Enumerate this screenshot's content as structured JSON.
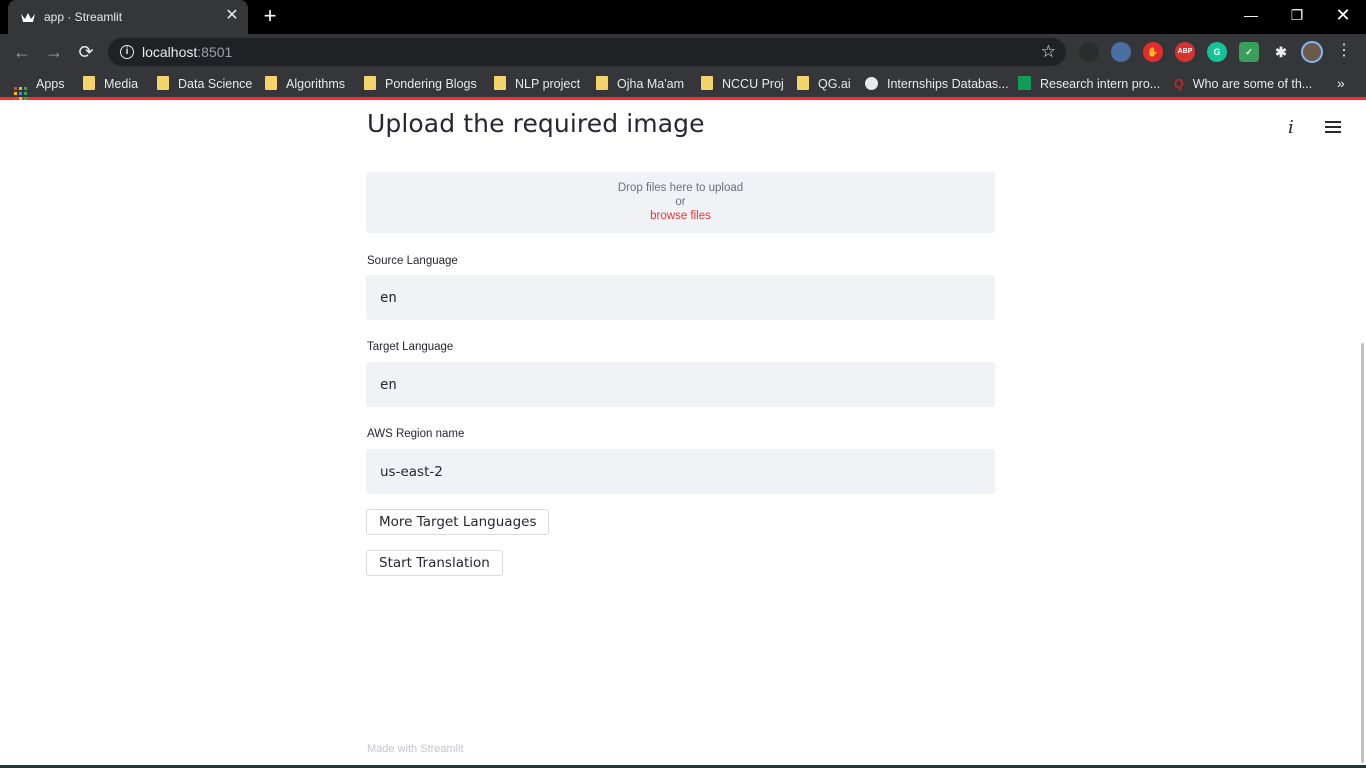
{
  "browser": {
    "tab_title": "app · Streamlit",
    "tab_close": "✕",
    "new_tab": "+",
    "window_controls": {
      "minimize": "—",
      "maximize": "❐",
      "close": "✕"
    },
    "nav": {
      "back": "←",
      "forward": "→",
      "reload": "⟳"
    },
    "url_host": "localhost",
    "url_port": ":8501",
    "bookmarks": [
      {
        "label": "Apps",
        "icon": "apps-grid-icon"
      },
      {
        "label": "Media",
        "icon": "folder-icon"
      },
      {
        "label": "Data Science",
        "icon": "folder-icon"
      },
      {
        "label": "Algorithms",
        "icon": "folder-icon"
      },
      {
        "label": "Pondering Blogs",
        "icon": "folder-icon"
      },
      {
        "label": "NLP project",
        "icon": "folder-icon"
      },
      {
        "label": "Ojha Ma'am",
        "icon": "folder-icon"
      },
      {
        "label": "NCCU Proj",
        "icon": "folder-icon"
      },
      {
        "label": "QG.ai",
        "icon": "folder-icon"
      },
      {
        "label": "Internships Databas...",
        "icon": "globe-icon"
      },
      {
        "label": "Research intern pro...",
        "icon": "sheets-icon"
      },
      {
        "label": "Who are some of th...",
        "icon": "quora-icon"
      }
    ],
    "extensions": {
      "abp": "ABP",
      "grammarly": "G"
    },
    "bookmarks_overflow": "»"
  },
  "app": {
    "about_icon": "i",
    "heading": "Upload the required image",
    "uploader": {
      "line1": "Drop files here to upload",
      "line2": "or",
      "link": "browse files"
    },
    "source_language": {
      "label": "Source Language",
      "value": "en"
    },
    "target_language": {
      "label": "Target Language",
      "value": "en"
    },
    "aws_region": {
      "label": "AWS Region name",
      "value": "us-east-2"
    },
    "more_languages_button": "More Target Languages",
    "start_button": "Start Translation",
    "footer": "Made with Streamlit"
  },
  "colors": {
    "accent": "#ff2b2b",
    "input_bg": "#f0f2f6",
    "text": "#262730",
    "chrome_dark": "#35363a"
  }
}
